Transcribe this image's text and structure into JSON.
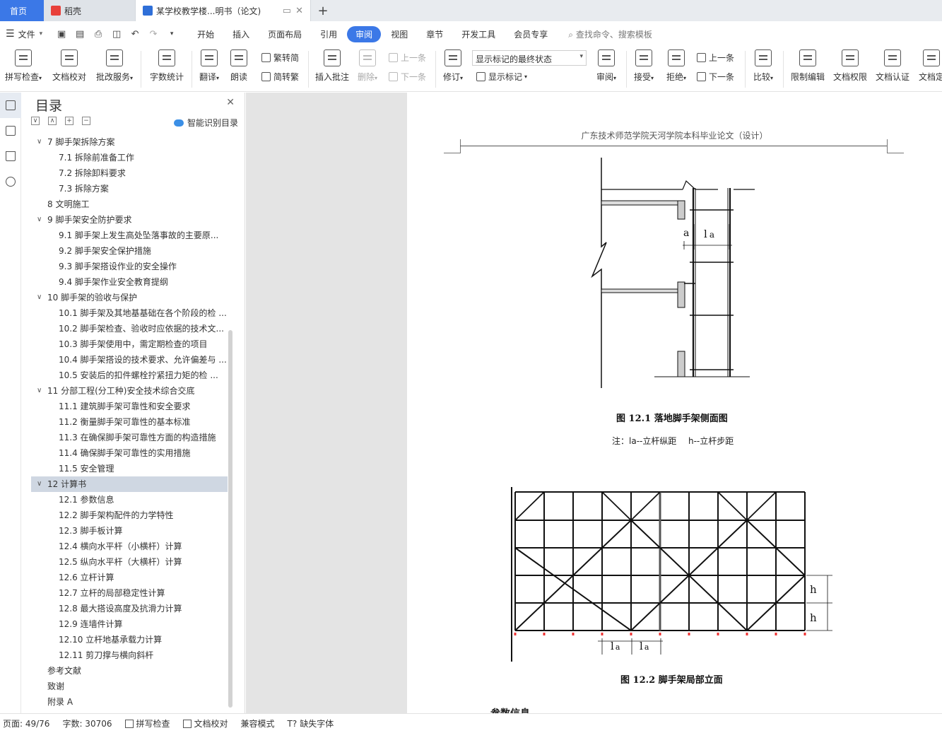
{
  "tabs": {
    "home": "首页",
    "docer": "稻壳",
    "doc": "某学校教学楼...明书（论文)"
  },
  "menu": {
    "file": "文件",
    "tabs": [
      "开始",
      "插入",
      "页面布局",
      "引用",
      "审阅",
      "视图",
      "章节",
      "开发工具",
      "会员专享"
    ],
    "active_tab": "审阅",
    "search": "查找命令、搜索模板"
  },
  "ribbon": {
    "spell": "拼写检查",
    "doccheck": "文档校对",
    "annotate_service": "批改服务",
    "wordcount": "字数统计",
    "translate": "翻译",
    "read": "朗读",
    "to_traditional": "繁转简",
    "to_simplified": "简转繁",
    "insert_comment": "插入批注",
    "delete": "删除",
    "prev": "上一条",
    "next": "下一条",
    "revise": "修订",
    "markup_dropdown": "显示标记的最终状态",
    "show_markup": "显示标记",
    "review": "审阅",
    "accept": "接受",
    "reject": "拒绝",
    "prev2": "上一条",
    "next2": "下一条",
    "compare": "比较",
    "restrict": "限制编辑",
    "doc_rights": "文档权限",
    "doc_cert": "文档认证",
    "doc_more": "文档定"
  },
  "toc": {
    "title": "目录",
    "smart": "智能识别目录",
    "items": [
      {
        "text": "7 脚手架拆除方案",
        "level": 1,
        "caret": true
      },
      {
        "text": "7.1 拆除前准备工作",
        "level": 2
      },
      {
        "text": "7.2 拆除卸料要求",
        "level": 2
      },
      {
        "text": "7.3 拆除方案",
        "level": 2
      },
      {
        "text": "8 文明施工",
        "level": 1
      },
      {
        "text": "9 脚手架安全防护要求",
        "level": 1,
        "caret": true
      },
      {
        "text": "9.1 脚手架上发生高处坠落事故的主要原...",
        "level": 2
      },
      {
        "text": "9.2 脚手架安全保护措施",
        "level": 2
      },
      {
        "text": "9.3 脚手架搭设作业的安全操作",
        "level": 2
      },
      {
        "text": "9.4 脚手架作业安全教育提纲",
        "level": 2
      },
      {
        "text": "10 脚手架的验收与保护",
        "level": 1,
        "caret": true
      },
      {
        "text": "10.1 脚手架及其地基基础在各个阶段的检 ...",
        "level": 2
      },
      {
        "text": "10.2 脚手架检查、验收时应依据的技术文...",
        "level": 2
      },
      {
        "text": "10.3 脚手架使用中，需定期检查的项目",
        "level": 2
      },
      {
        "text": "10.4 脚手架搭设的技术要求、允许偏差与 ...",
        "level": 2
      },
      {
        "text": "10.5    安装后的扣件螺栓拧紧扭力矩的检 ...",
        "level": 2
      },
      {
        "text": "11 分部工程(分工种)安全技术综合交底",
        "level": 1,
        "caret": true
      },
      {
        "text": "11.1 建筑脚手架可靠性和安全要求",
        "level": 2
      },
      {
        "text": "11.2 衡量脚手架可靠性的基本标准",
        "level": 2
      },
      {
        "text": "11.3 在确保脚手架可靠性方面的构造措施",
        "level": 2
      },
      {
        "text": "11.4 确保脚手架可靠性的实用措施",
        "level": 2
      },
      {
        "text": "11.5 安全管理",
        "level": 2
      },
      {
        "text": "12 计算书",
        "level": 1,
        "caret": true,
        "selected": true
      },
      {
        "text": "12.1 参数信息",
        "level": 2
      },
      {
        "text": "12.2 脚手架构配件的力学特性",
        "level": 2
      },
      {
        "text": "12.3 脚手板计算",
        "level": 2
      },
      {
        "text": "12.4 横向水平杆（小横杆）计算",
        "level": 2
      },
      {
        "text": "12.5 纵向水平杆（大横杆）计算",
        "level": 2
      },
      {
        "text": "12.6 立杆计算",
        "level": 2
      },
      {
        "text": "12.7 立杆的局部稳定性计算",
        "level": 2
      },
      {
        "text": "12.8 最大搭设高度及抗滑力计算",
        "level": 2
      },
      {
        "text": "12.9 连墙件计算",
        "level": 2
      },
      {
        "text": "12.10 立杆地基承载力计算",
        "level": 2
      },
      {
        "text": "12.11 剪刀撑与横向斜杆",
        "level": 2
      },
      {
        "text": "参考文献",
        "level": 1
      },
      {
        "text": "致谢",
        "level": 1
      },
      {
        "text": "附录 A",
        "level": 1
      }
    ]
  },
  "document": {
    "header": "广东技术师范学院天河学院本科毕业论文（设计）",
    "fig1_caption": "图 12.1  落地脚手架侧面图",
    "fig1_note_la": "注：la--立杆纵距",
    "fig1_note_h": "h--立杆步距",
    "fig1_label_a": "a",
    "fig1_label_la": "l",
    "fig1_label_la_sub": "a",
    "fig2_caption": "图 12.2  脚手架局部立面",
    "fig2_h": "h",
    "fig2_la": "l",
    "fig2_la_sub": "a",
    "bottom_text": "参数信息"
  },
  "status": {
    "page": "页面: 49/76",
    "words": "字数: 30706",
    "spell": "拼写检查",
    "doccheck": "文档校对",
    "compat": "兼容模式",
    "missing_font": "缺失字体"
  }
}
